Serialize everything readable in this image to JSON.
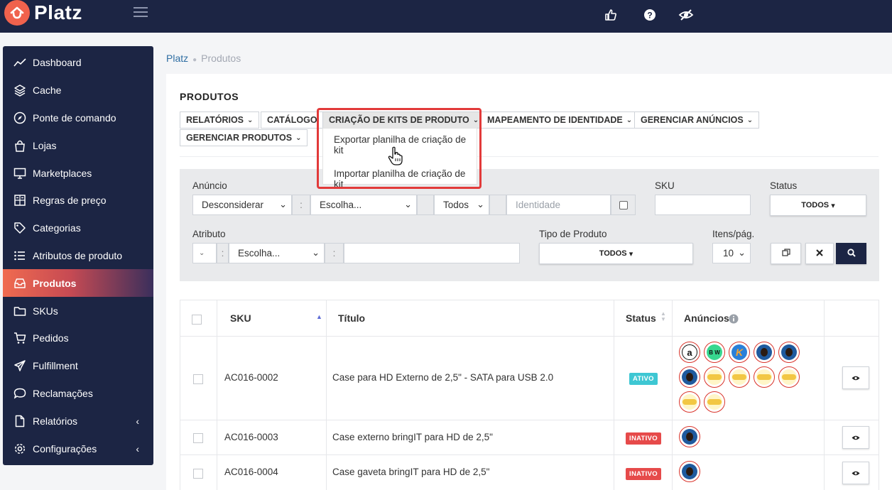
{
  "app": {
    "brand": "Platz"
  },
  "sidebar": {
    "items": [
      {
        "label": "Dashboard",
        "icon": "chart-line-icon"
      },
      {
        "label": "Cache",
        "icon": "layers-icon"
      },
      {
        "label": "Ponte de comando",
        "icon": "compass-icon"
      },
      {
        "label": "Lojas",
        "icon": "shopping-bag-icon"
      },
      {
        "label": "Marketplaces",
        "icon": "monitor-icon"
      },
      {
        "label": "Regras de preço",
        "icon": "calculator-icon"
      },
      {
        "label": "Categorias",
        "icon": "tag-icon"
      },
      {
        "label": "Atributos de produto",
        "icon": "list-icon"
      },
      {
        "label": "Produtos",
        "icon": "inbox-icon",
        "active": true
      },
      {
        "label": "SKUs",
        "icon": "folder-icon"
      },
      {
        "label": "Pedidos",
        "icon": "cart-icon"
      },
      {
        "label": "Fulfillment",
        "icon": "plane-icon"
      },
      {
        "label": "Reclamações",
        "icon": "chat-icon"
      },
      {
        "label": "Relatórios",
        "icon": "file-icon"
      },
      {
        "label": "Configurações",
        "icon": "gear-icon"
      }
    ]
  },
  "breadcrumb": {
    "home": "Platz",
    "current": "Produtos"
  },
  "page": {
    "title": "PRODUTOS"
  },
  "toolbar": {
    "relatorios": "RELATÓRIOS",
    "catalogo": "CATÁLOGO",
    "kits": "CRIAÇÃO DE KITS DE PRODUTO",
    "mapeamento": "MAPEAMENTO DE IDENTIDADE",
    "anuncios": "GERENCIAR ANÚNCIOS",
    "gerenciar_produtos": "GERENCIAR PRODUTOS"
  },
  "kits_menu": {
    "export": "Exportar planilha de criação de kit",
    "import": "Importar planilha de criação de kit"
  },
  "filters": {
    "anuncio_label": "Anúncio",
    "anuncio_mode": "Desconsiderar",
    "colon": ":",
    "anuncio_choice": "Escolha...",
    "anuncio_scope": "Todos",
    "identidade_placeholder": "Identidade",
    "sku_label": "SKU",
    "status_label": "Status",
    "status_value": "TODOS",
    "atributo_label": "Atributo",
    "atributo_choice": "Escolha...",
    "tipo_label": "Tipo de Produto",
    "tipo_value": "TODOS",
    "itens_label": "Itens/pág.",
    "itens_value": "10"
  },
  "table": {
    "headers": {
      "sku": "SKU",
      "titulo": "Título",
      "status": "Status",
      "anuncios": "Anúncios"
    },
    "rows": [
      {
        "sku": "AC016-0002",
        "titulo": "Case para HD Externo de 2,5\" - SATA para USB 2.0",
        "status": "ATIVO"
      },
      {
        "sku": "AC016-0003",
        "titulo": "Case externo bringIT para HD de 2,5\"",
        "status": "INATIVO"
      },
      {
        "sku": "AC016-0004",
        "titulo": "Case gaveta bringIT para HD de 2,5\"",
        "status": "INATIVO"
      }
    ]
  },
  "colors": {
    "navy": "#1c2544",
    "accent": "#f0624d",
    "ativo": "#3ec7d3",
    "inativo": "#e64a4a",
    "highlight": "#e23a3a"
  }
}
